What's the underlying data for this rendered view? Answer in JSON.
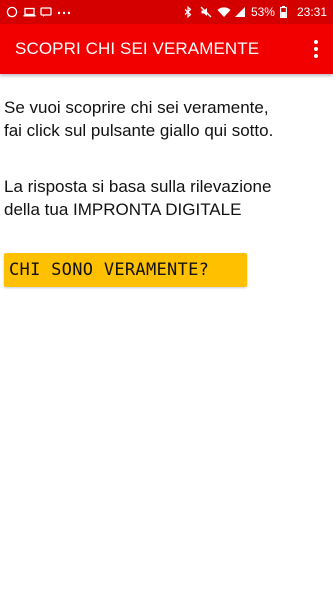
{
  "status_bar": {
    "battery_percent": "53%",
    "time": "23:31",
    "left_icons": [
      "whatsapp-icon",
      "laptop-icon",
      "message-icon",
      "more-dots-icon"
    ],
    "right_icons": [
      "bluetooth-icon",
      "mute-icon",
      "wifi-icon",
      "signal-icon",
      "battery-icon"
    ]
  },
  "app_bar": {
    "title": "SCOPRI CHI SEI VERAMENTE",
    "menu_icon": "overflow-menu-icon"
  },
  "content": {
    "intro_line1": "Se vuoi scoprire chi sei veramente,",
    "intro_line2": "fai click sul pulsante giallo qui sotto.",
    "info_line1": "La risposta si basa sulla rilevazione",
    "info_line2": "della tua IMPRONTA DIGITALE"
  },
  "action_button": {
    "label": "CHI SONO VERAMENTE?"
  },
  "colors": {
    "status_bar": "#d40000",
    "app_bar": "#f20000",
    "button": "#ffc000"
  }
}
